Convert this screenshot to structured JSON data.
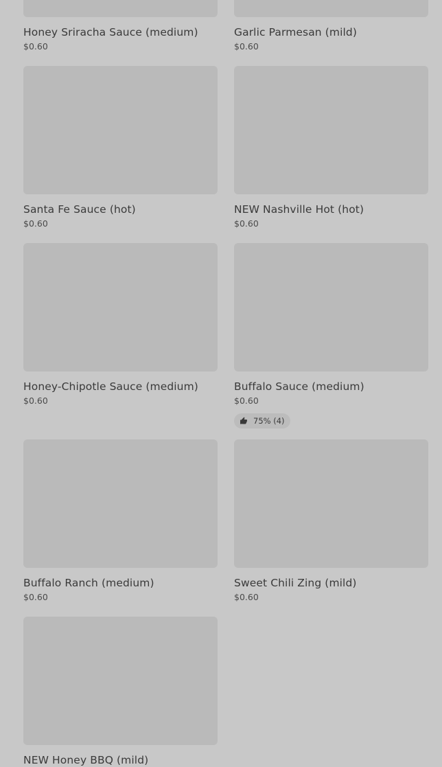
{
  "items": [
    {
      "name": "Honey Sriracha Sauce (medium)",
      "price": "$0.60"
    },
    {
      "name": "Garlic Parmesan (mild)",
      "price": "$0.60"
    },
    {
      "name": "Santa Fe Sauce (hot)",
      "price": "$0.60"
    },
    {
      "name": "NEW Nashville Hot (hot)",
      "price": "$0.60"
    },
    {
      "name": "Honey-Chipotle Sauce (medium)",
      "price": "$0.60"
    },
    {
      "name": "Buffalo Sauce (medium)",
      "price": "$0.60",
      "rating": {
        "text": "75% (4)",
        "icon": "thumbs-up-icon"
      }
    },
    {
      "name": "Buffalo Ranch (medium)",
      "price": "$0.60"
    },
    {
      "name": "Sweet Chili Zing (mild)",
      "price": "$0.60"
    },
    {
      "name": "NEW Honey BBQ (mild)",
      "price": ""
    }
  ]
}
